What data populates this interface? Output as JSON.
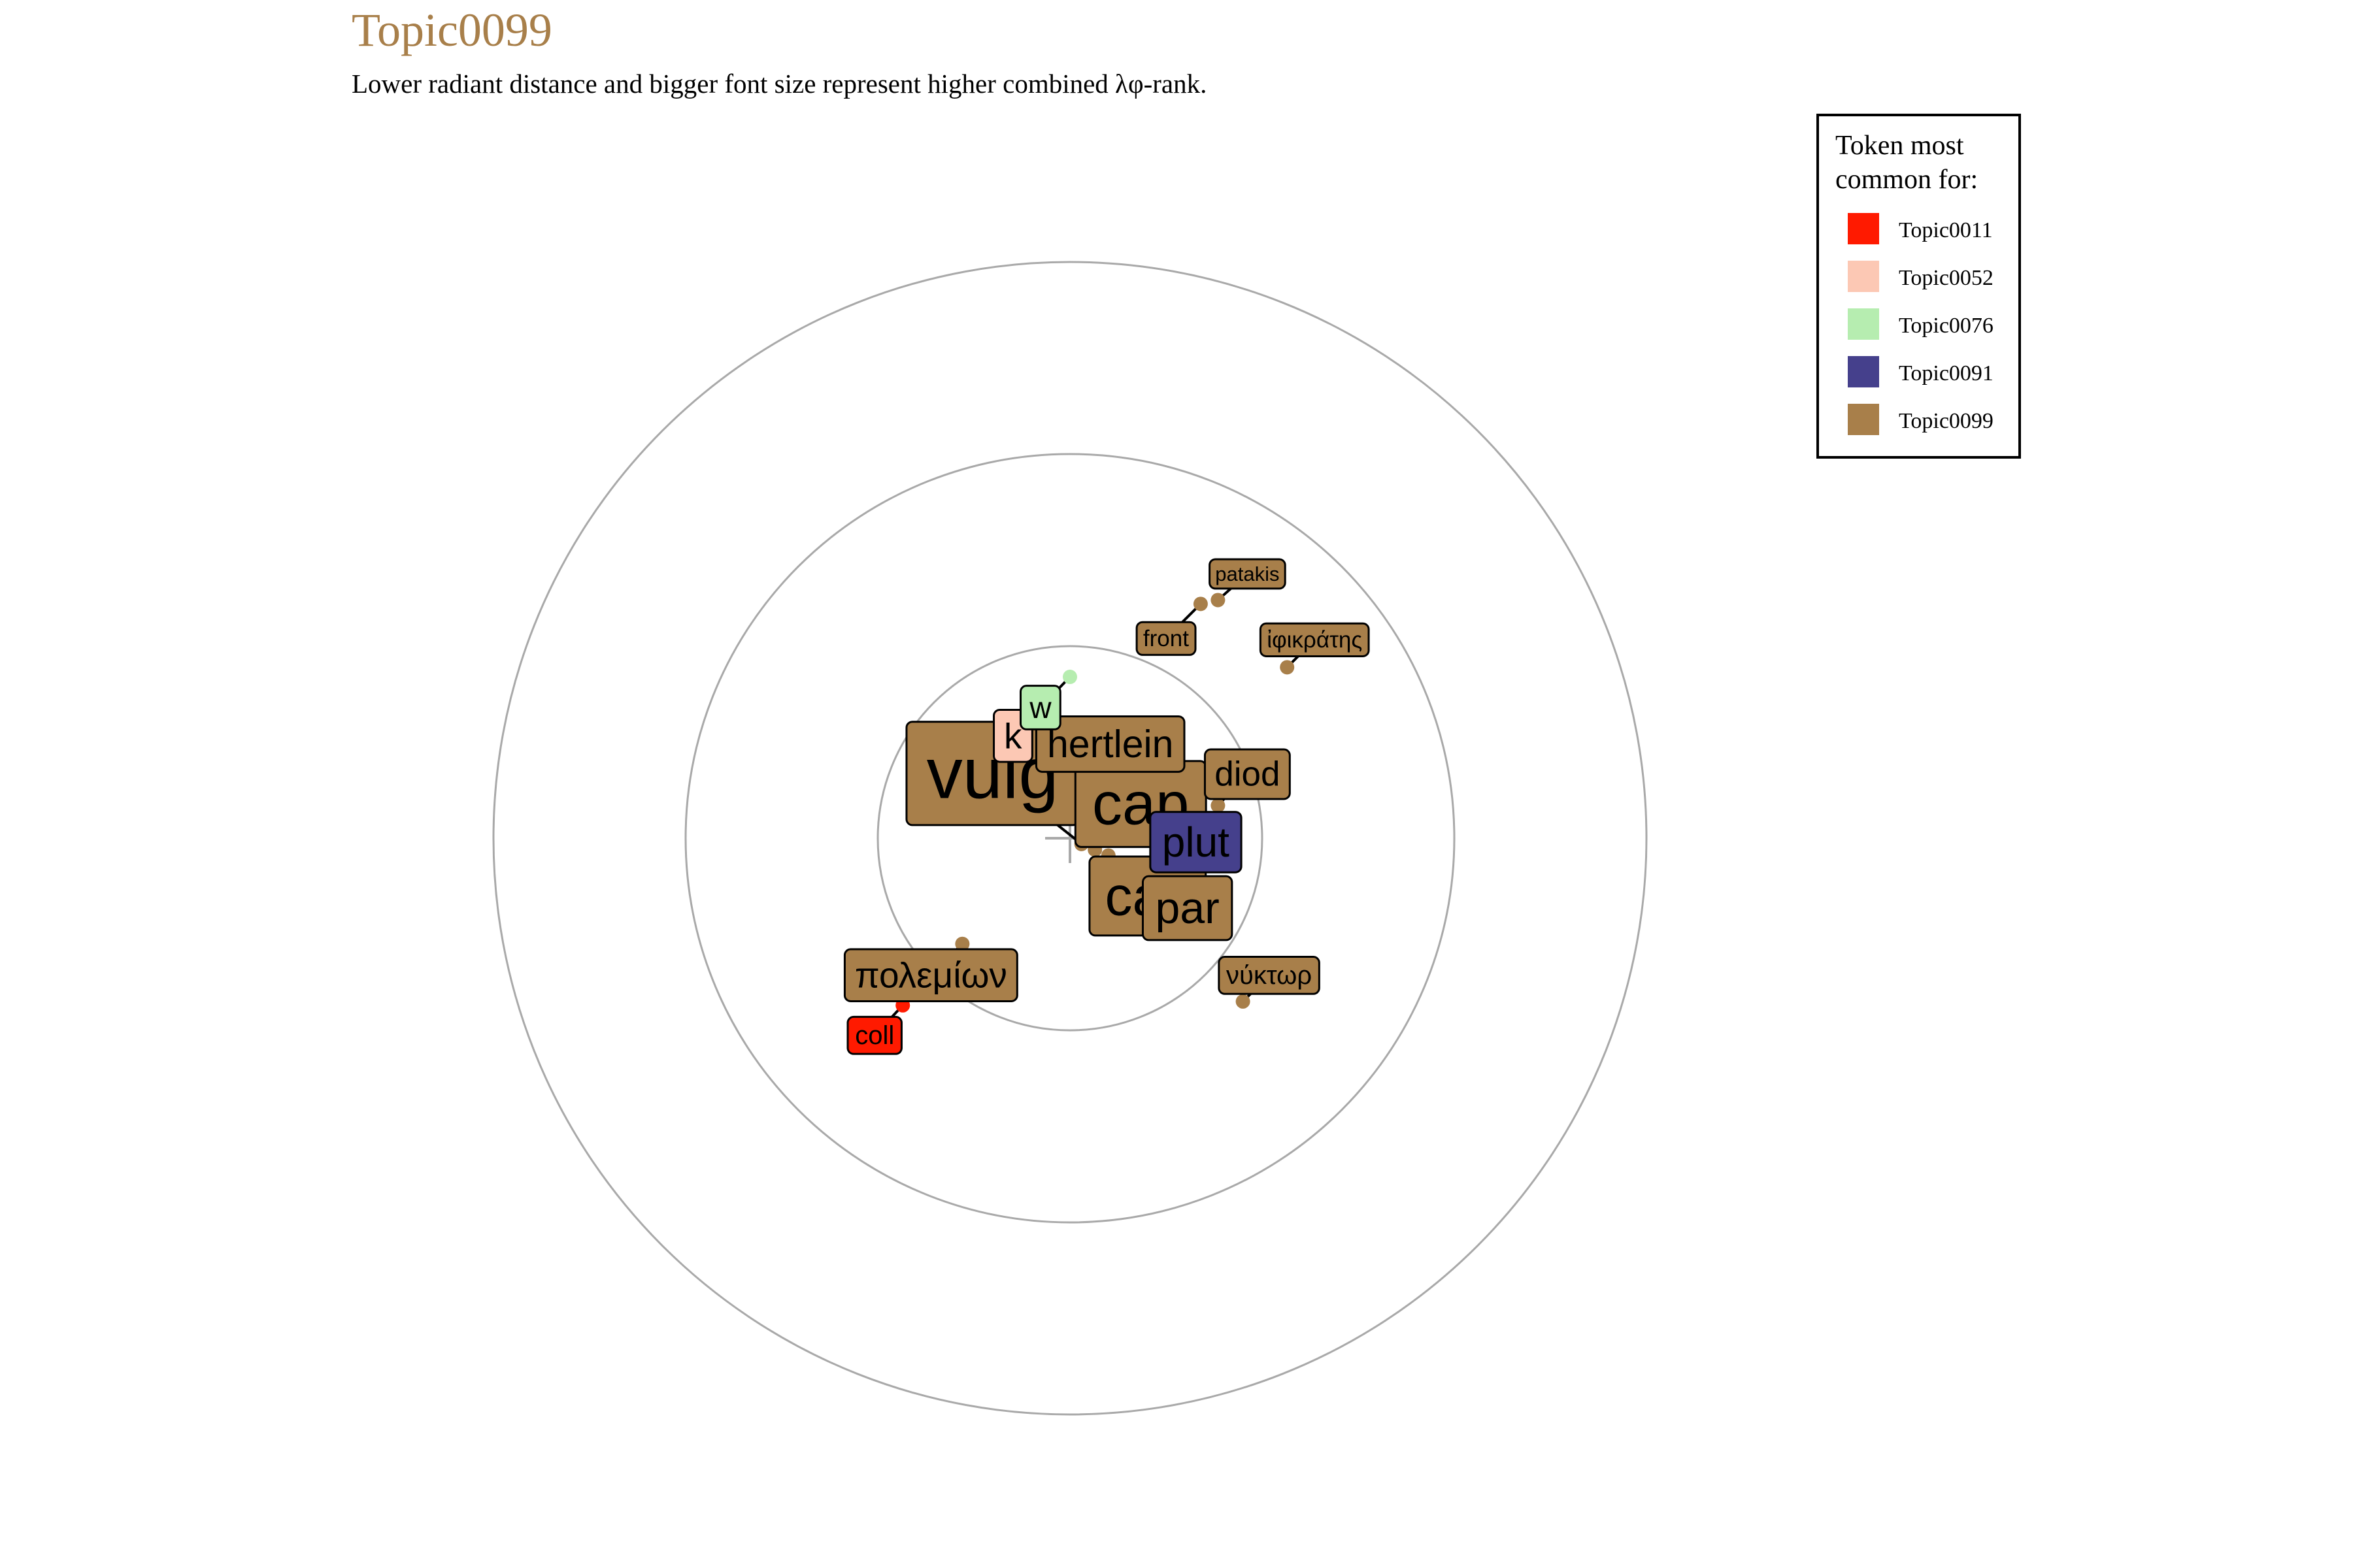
{
  "title": "Topic0099",
  "subtitle": "Lower radiant distance and bigger font size represent higher combined λφ-rank.",
  "colors": {
    "title": "#A87F4A",
    "ring": "#A9A9A9",
    "leader": "#000000"
  },
  "legend": {
    "title_line1": "Token most",
    "title_line2": "common for:",
    "placement": "top-right",
    "entries": [
      {
        "label": "Topic0011",
        "color": "#FF1A00"
      },
      {
        "label": "Topic0052",
        "color": "#FCC8B4"
      },
      {
        "label": "Topic0076",
        "color": "#B6EDB0"
      },
      {
        "label": "Topic0091",
        "color": "#45408C"
      },
      {
        "label": "Topic0099",
        "color": "#A87F4A"
      }
    ]
  },
  "chart_data": {
    "type": "scatter",
    "coordinate_system": "polar rank plot",
    "rings": [
      1,
      2,
      3
    ],
    "points": [
      {
        "token": "vulg",
        "topic": "Topic0099",
        "x": 0.06,
        "y": -0.03,
        "size": 5
      },
      {
        "token": "cap",
        "topic": "Topic0099",
        "x": 0.13,
        "y": -0.06,
        "size": 4.2
      },
      {
        "token": "cas",
        "topic": "Topic0099",
        "x": 0.2,
        "y": -0.09,
        "size": 3.8
      },
      {
        "token": "par",
        "topic": "Topic0099",
        "x": 0.39,
        "y": -0.16,
        "size": 3.1
      },
      {
        "token": "plut",
        "topic": "Topic0091",
        "x": 0.44,
        "y": 0.16,
        "size": 2.9
      },
      {
        "token": "hertlein",
        "topic": "Topic0099",
        "x": 0.38,
        "y": 0.32,
        "size": 2.7
      },
      {
        "token": "k",
        "topic": "Topic0052",
        "x": -0.45,
        "y": 0.38,
        "size": 2.5
      },
      {
        "token": "diod",
        "topic": "Topic0099",
        "x": 0.77,
        "y": 0.17,
        "size": 2.4
      },
      {
        "token": "w",
        "topic": "Topic0076",
        "x": 0.0,
        "y": 0.84,
        "size": 2.1
      },
      {
        "token": "πολεμίων",
        "topic": "Topic0099",
        "x": -0.56,
        "y": -0.55,
        "size": 2.5
      },
      {
        "token": "coll",
        "topic": "Topic0011",
        "x": -0.87,
        "y": -0.87,
        "size": 1.8
      },
      {
        "token": "νύκτωρ",
        "topic": "Topic0099",
        "x": 0.9,
        "y": -0.85,
        "size": 1.8
      },
      {
        "token": "front",
        "topic": "Topic0099",
        "x": 0.68,
        "y": 1.22,
        "size": 1.6
      },
      {
        "token": "patakis",
        "topic": "Topic0099",
        "x": 0.77,
        "y": 1.24,
        "size": 1.4
      },
      {
        "token": "ἰφικράτης",
        "topic": "Topic0099",
        "x": 1.13,
        "y": 0.89,
        "size": 1.6
      }
    ]
  }
}
